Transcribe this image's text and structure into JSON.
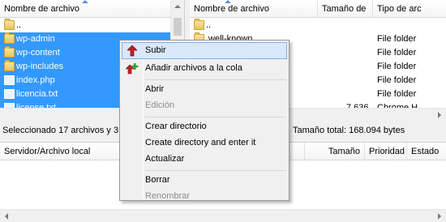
{
  "colors": {
    "selection": "#3399ff",
    "menu_highlight": "#d9e8fb",
    "upload_arrow": "#c0202a",
    "add_plus": "#2ca02c"
  },
  "local_pane": {
    "header": {
      "name": "Nombre de archivo"
    },
    "rows": [
      {
        "name": "..",
        "type": "folder-icon",
        "selected": false
      },
      {
        "name": "wp-admin",
        "type": "folder-icon",
        "selected": true
      },
      {
        "name": "wp-content",
        "type": "folder-icon",
        "selected": true
      },
      {
        "name": "wp-includes",
        "type": "folder-icon",
        "selected": true
      },
      {
        "name": "index.php",
        "type": "file-icon",
        "selected": true
      },
      {
        "name": "licencia.txt",
        "type": "file-icon",
        "selected": true
      },
      {
        "name": "license.txt",
        "type": "file-icon",
        "selected": true
      }
    ],
    "status": "Seleccionado 17 archivos y 3 d"
  },
  "remote_pane": {
    "header": {
      "name": "Nombre de archivo",
      "size": "Tamaño de",
      "type": "Tipo de arc"
    },
    "rows": [
      {
        "name": "..",
        "size": "",
        "type": ""
      },
      {
        "name": ".well-known",
        "size": "",
        "type": "File folder"
      },
      {
        "name": "",
        "size": "",
        "type": "File folder"
      },
      {
        "name": "",
        "size": "",
        "type": "File folder"
      },
      {
        "name": "",
        "size": "",
        "type": "File folder"
      },
      {
        "name": "",
        "size": "",
        "type": "File folder"
      },
      {
        "name": "",
        "size": "7.636",
        "type": "Chrome H..."
      }
    ],
    "status": "Tamaño total: 168.094 bytes"
  },
  "queue": {
    "headers": {
      "server": "Servidor/Archivo local",
      "size": "Tamaño",
      "priority": "Prioridad",
      "state": "Estado"
    }
  },
  "context_menu": {
    "items": [
      {
        "label": "Subir",
        "icon": "upload-arrow-icon",
        "highlighted": true,
        "disabled": false
      },
      {
        "label": "Añadir archivos a la cola",
        "icon": "add-to-queue-icon",
        "highlighted": false,
        "disabled": false
      },
      {
        "label": "Abrir",
        "highlighted": false,
        "disabled": false
      },
      {
        "label": "Edición",
        "highlighted": false,
        "disabled": true
      },
      {
        "label": "Crear directorio",
        "highlighted": false,
        "disabled": false
      },
      {
        "label": "Create directory and enter it",
        "highlighted": false,
        "disabled": false
      },
      {
        "label": "Actualizar",
        "highlighted": false,
        "disabled": false
      },
      {
        "label": "Borrar",
        "highlighted": false,
        "disabled": false
      },
      {
        "label": "Renombrar",
        "highlighted": false,
        "disabled": true
      }
    ]
  }
}
